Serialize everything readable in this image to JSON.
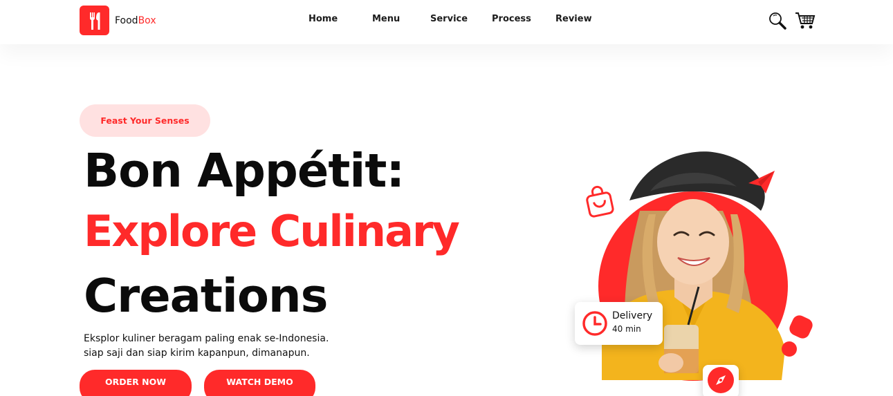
{
  "brand": {
    "name_part1": "Food",
    "name_part2": "Box"
  },
  "nav": [
    {
      "label": "Home"
    },
    {
      "label": "Menu"
    },
    {
      "label": "Service"
    },
    {
      "label": "Process"
    },
    {
      "label": "Review"
    }
  ],
  "header_icons": [
    "search-icon",
    "cart-icon"
  ],
  "hero": {
    "tag": "Feast Your Senses",
    "headline_line1": "Bon Appétit:",
    "headline_line2": "Explore Culinary",
    "headline_line3": "Creations",
    "description_line1": "Eksplor kuliner beragam paling enak se-Indonesia.",
    "description_line2": "siap saji dan siap kirim kapanpun, dimanapun.",
    "primary_button": "ORDER NOW",
    "secondary_button": "WATCH DEMO"
  },
  "delivery_badge": {
    "title": "Delivery",
    "time": "40 min"
  },
  "decor_icons": [
    "shopping-bag-icon",
    "paper-plane-icon",
    "clock-icon",
    "compass-icon"
  ],
  "colors": {
    "accent": "#ff2a2a",
    "accent_soft": "#ffe1e1",
    "text": "#0b0b0b"
  }
}
